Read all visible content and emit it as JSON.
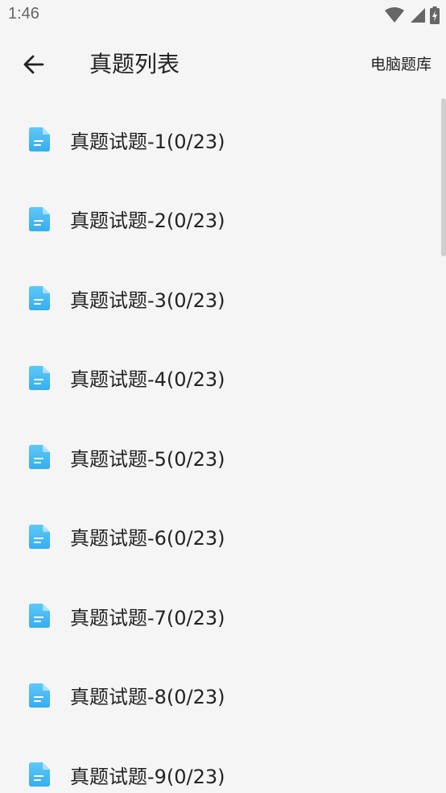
{
  "status_bar": {
    "time": "1:46",
    "icons": [
      "wifi-icon",
      "signal-icon",
      "battery-charging-icon"
    ]
  },
  "app_bar": {
    "back_icon": "arrow-left-icon",
    "title": "真题列表",
    "action_label": "电脑题库"
  },
  "list": {
    "icon": "document-icon",
    "accent_color": "#3bb5f3",
    "items": [
      {
        "label": "真题试题-1(0/23)"
      },
      {
        "label": "真题试题-2(0/23)"
      },
      {
        "label": "真题试题-3(0/23)"
      },
      {
        "label": "真题试题-4(0/23)"
      },
      {
        "label": "真题试题-5(0/23)"
      },
      {
        "label": "真题试题-6(0/23)"
      },
      {
        "label": "真题试题-7(0/23)"
      },
      {
        "label": "真题试题-8(0/23)"
      },
      {
        "label": "真题试题-9(0/23)"
      }
    ]
  }
}
